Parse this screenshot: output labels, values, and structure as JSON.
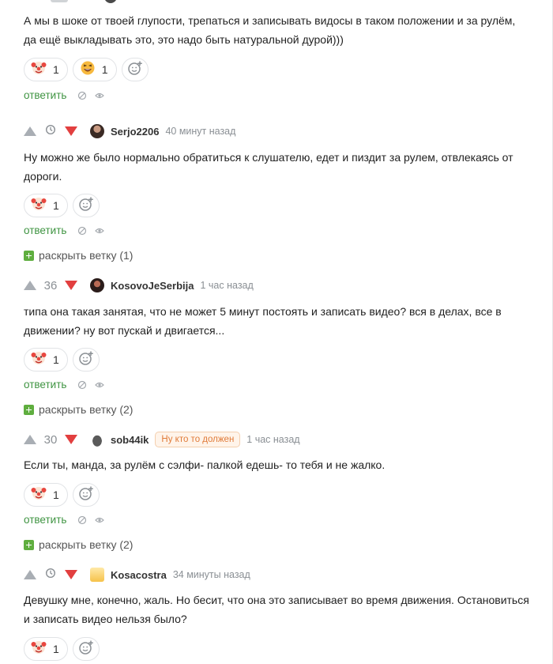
{
  "colors": {
    "reply_green": "#3f9442",
    "down_red": "#e23f3f",
    "up_grey": "#a9aeb4",
    "badge_orange": "#e07b39"
  },
  "icons": {
    "clown": "clown-emoji-icon",
    "laugh": "laughing-emoji-icon",
    "add_reaction": "add-reaction-icon",
    "timer": "timer-icon",
    "hide": "hide-icon",
    "view": "eye-icon"
  },
  "top_comment": {
    "text": "А мы в шоке от твоей глупости, трепаться и записывать видосы в таком положении и за рулём, да ещё выкладывать это, это надо быть натуральной дурой)))",
    "reactions": [
      {
        "emoji": "clown",
        "count": "1"
      },
      {
        "emoji": "laugh",
        "count": "1"
      }
    ],
    "reply_label": "ответить"
  },
  "comments": [
    {
      "rating": "",
      "username": "Serjo2206",
      "time": "40 минут назад",
      "text": "Ну можно же было нормально обратиться к слушателю, едет и пиздит за рулем, отвлекаясь от дороги.",
      "reactions": [
        {
          "emoji": "clown",
          "count": "1"
        }
      ],
      "reply_label": "ответить",
      "expand_label": "раскрыть ветку (1)"
    },
    {
      "rating": "36",
      "username": "KosovoJeSerbija",
      "time": "1 час назад",
      "text": "типа она такая занятая, что не может 5 минут постоять и записать видео? вся в делах, все в движении? ну вот пускай и двигается...",
      "reactions": [
        {
          "emoji": "clown",
          "count": "1"
        }
      ],
      "reply_label": "ответить",
      "expand_label": "раскрыть ветку (2)"
    },
    {
      "rating": "30",
      "username": "sob44ik",
      "badge": "Ну кто то должен",
      "time": "1 час назад",
      "text": "Если ты, манда, за рулём с сэлфи- палкой едешь- то тебя и не жалко.",
      "reactions": [
        {
          "emoji": "clown",
          "count": "1"
        }
      ],
      "reply_label": "ответить",
      "expand_label": "раскрыть ветку (2)"
    },
    {
      "rating": "",
      "username": "Kosacostra",
      "time": "34 минуты назад",
      "text": "Девушку мне, конечно, жаль. Но бесит, что она это записывает во время движения. Остановиться и записать видео нельзя было?",
      "reactions": [
        {
          "emoji": "clown",
          "count": "1"
        }
      ]
    }
  ]
}
